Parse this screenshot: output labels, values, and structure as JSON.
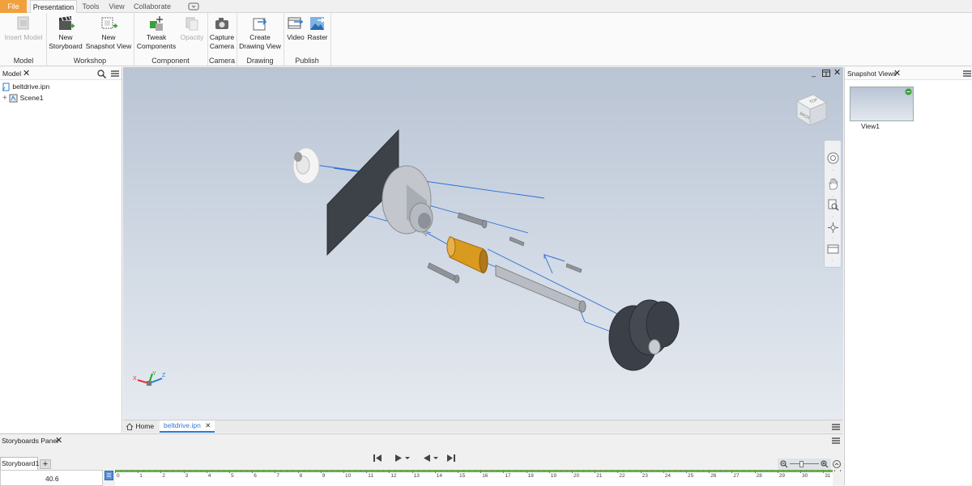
{
  "menu": {
    "file": "File",
    "presentation": "Presentation",
    "tools": "Tools",
    "view": "View",
    "collaborate": "Collaborate"
  },
  "ribbon": {
    "insert_model": "Insert Model",
    "model_group": "Model",
    "new_storyboard_1": "New",
    "new_storyboard_2": "Storyboard",
    "new_snapshot_1": "New",
    "new_snapshot_2": "Snapshot View",
    "workshop_group": "Workshop",
    "tweak_1": "Tweak",
    "tweak_2": "Components",
    "opacity": "Opacity",
    "component_group": "Component",
    "capture_1": "Capture",
    "capture_2": "Camera",
    "camera_group": "Camera",
    "create_1": "Create",
    "create_2": "Drawing View",
    "drawing_group": "Drawing",
    "video": "Video",
    "raster": "Raster",
    "publish_group": "Publish"
  },
  "model_panel": {
    "title": "Model",
    "file": "beltdrive.ipn",
    "scene": "Scene1"
  },
  "viewcube": {
    "top": "TOP",
    "back": "BACK"
  },
  "triad": {
    "x": "X",
    "y": "Y",
    "z": "Z"
  },
  "doc_tabs": {
    "home": "Home",
    "active": "beltdrive.ipn"
  },
  "snapshot_panel": {
    "title": "Snapshot Views",
    "view1": "View1"
  },
  "storyboard": {
    "panel_title": "Storyboards Panel",
    "tab": "Storyboard1",
    "time_value": "40.6",
    "ruler": [
      "0",
      "1",
      "2",
      "3",
      "4",
      "5",
      "6",
      "7",
      "8",
      "9",
      "10",
      "11",
      "12",
      "13",
      "14",
      "15",
      "16",
      "17",
      "18",
      "19",
      "20",
      "21",
      "22",
      "23",
      "24",
      "25",
      "26",
      "27",
      "28",
      "29",
      "30",
      "31"
    ]
  },
  "colors": {
    "file_tab": "#f2a03b",
    "accent": "#2b7bd6",
    "timeline_green": "#6ab04c"
  }
}
